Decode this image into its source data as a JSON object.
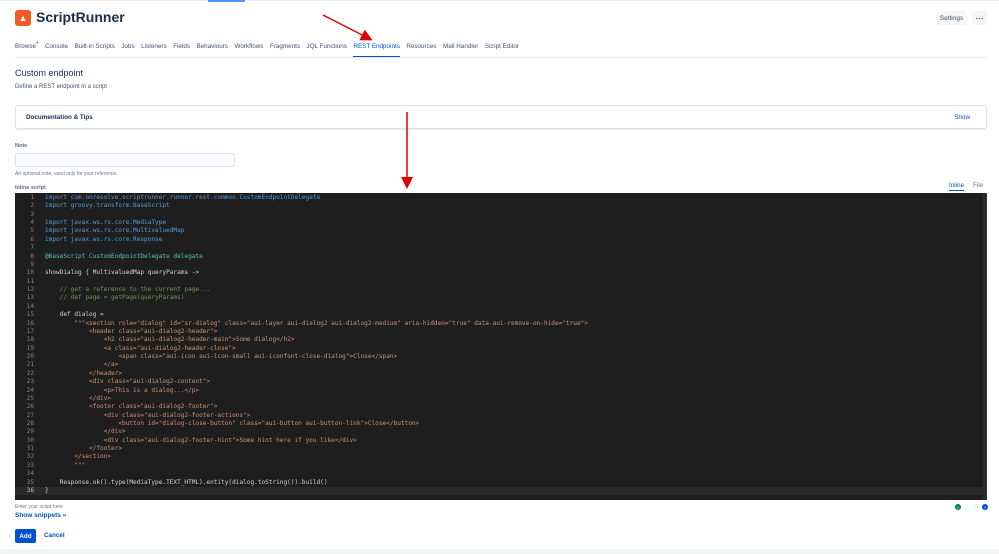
{
  "header": {
    "app_title": "ScriptRunner",
    "settings_label": "Settings",
    "more_label": "⋯"
  },
  "nav": {
    "tabs": [
      {
        "label": "Browse",
        "badge": "•"
      },
      {
        "label": "Console"
      },
      {
        "label": "Built-in Scripts"
      },
      {
        "label": "Jobs"
      },
      {
        "label": "Listeners"
      },
      {
        "label": "Fields"
      },
      {
        "label": "Behaviours"
      },
      {
        "label": "Workflows"
      },
      {
        "label": "Fragments"
      },
      {
        "label": "JQL Functions"
      },
      {
        "label": "REST Endpoints",
        "active": true
      },
      {
        "label": "Resources"
      },
      {
        "label": "Mail Handler"
      },
      {
        "label": "Script Editor"
      }
    ]
  },
  "page": {
    "title": "Custom endpoint",
    "subtitle": "Define a REST endpoint in a script"
  },
  "docs": {
    "title": "Documentation & Tips",
    "show_label": "Show"
  },
  "note": {
    "label": "Note",
    "value": "",
    "help": "An optional note, used only for your reference."
  },
  "script": {
    "label": "Inline script",
    "tabs": [
      {
        "label": "Inline",
        "active": true
      },
      {
        "label": "File"
      }
    ],
    "help": "Enter your script here",
    "snippets_label": "Show snippets »",
    "current_line": 36,
    "lines": [
      {
        "t": "import com.onresolve.scriptrunner.runner.rest.common.CustomEndpointDelegate",
        "k": "import"
      },
      {
        "t": "import groovy.transform.BaseScript",
        "k": "import"
      },
      {
        "t": "",
        "k": "plain"
      },
      {
        "t": "import javax.ws.rs.core.MediaType",
        "k": "import"
      },
      {
        "t": "import javax.ws.rs.core.MultivaluedMap",
        "k": "import"
      },
      {
        "t": "import javax.ws.rs.core.Response",
        "k": "import"
      },
      {
        "t": "",
        "k": "plain"
      },
      {
        "t": "@BaseScript CustomEndpointDelegate delegate",
        "k": "type"
      },
      {
        "t": "",
        "k": "plain"
      },
      {
        "t": "showDialog { MultivaluedMap queryParams ->",
        "k": "plain"
      },
      {
        "t": "",
        "k": "plain"
      },
      {
        "t": "    // get a reference to the current page...",
        "k": "comment"
      },
      {
        "t": "    // def page = getPage(queryParams)",
        "k": "comment"
      },
      {
        "t": "",
        "k": "plain"
      },
      {
        "t": "    def dialog =",
        "k": "plain"
      },
      {
        "t": "        \"\"\"<section role=\"dialog\" id=\"sr-dialog\" class=\"aui-layer aui-dialog2 aui-dialog2-medium\" aria-hidden=\"true\" data-aui-remove-on-hide=\"true\">",
        "k": "string"
      },
      {
        "t": "            <header class=\"aui-dialog2-header\">",
        "k": "string"
      },
      {
        "t": "                <h2 class=\"aui-dialog2-header-main\">Some dialog</h2>",
        "k": "string"
      },
      {
        "t": "                <a class=\"aui-dialog2-header-close\">",
        "k": "string"
      },
      {
        "t": "                    <span class=\"aui-icon aui-icon-small aui-iconfont-close-dialog\">Close</span>",
        "k": "string"
      },
      {
        "t": "                </a>",
        "k": "string"
      },
      {
        "t": "            </header>",
        "k": "string"
      },
      {
        "t": "            <div class=\"aui-dialog2-content\">",
        "k": "string"
      },
      {
        "t": "                <p>This is a dialog...</p>",
        "k": "string"
      },
      {
        "t": "            </div>",
        "k": "string"
      },
      {
        "t": "            <footer class=\"aui-dialog2-footer\">",
        "k": "string"
      },
      {
        "t": "                <div class=\"aui-dialog2-footer-actions\">",
        "k": "string"
      },
      {
        "t": "                    <button id=\"dialog-close-button\" class=\"aui-button aui-button-link\">Close</button>",
        "k": "string"
      },
      {
        "t": "                </div>",
        "k": "string"
      },
      {
        "t": "                <div class=\"aui-dialog2-footer-hint\">Some hint here if you like</div>",
        "k": "string"
      },
      {
        "t": "            </footer>",
        "k": "string"
      },
      {
        "t": "        </section>",
        "k": "string"
      },
      {
        "t": "        \"\"\"",
        "k": "string"
      },
      {
        "t": "",
        "k": "plain"
      },
      {
        "t": "    Response.ok().type(MediaType.TEXT_HTML).entity(dialog.toString()).build()",
        "k": "plain"
      },
      {
        "t": "}",
        "k": "plain"
      }
    ]
  },
  "actions": {
    "add_label": "Add",
    "cancel_label": "Cancel"
  },
  "colors": {
    "brand": "#f15a24",
    "accent": "#0052cc",
    "annotation": "#e00000",
    "editor_bg": "#1e1e1e"
  }
}
